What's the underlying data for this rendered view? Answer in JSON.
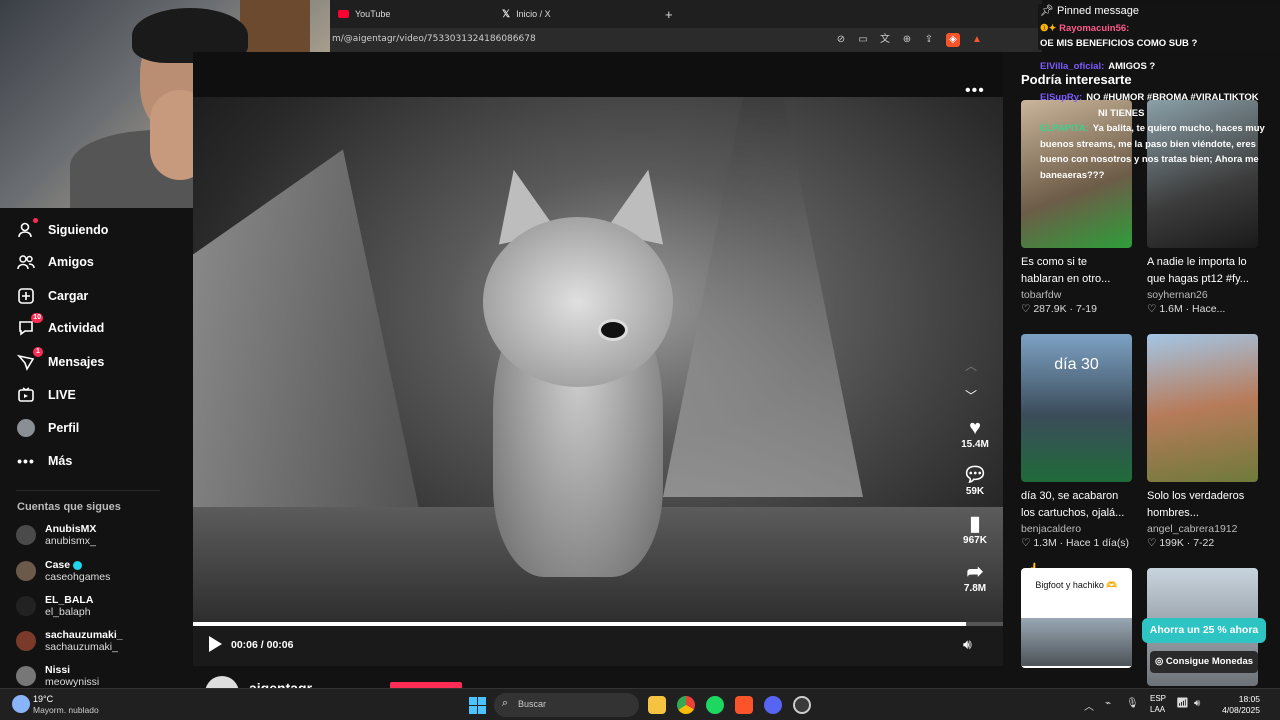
{
  "browser": {
    "tabs": [
      {
        "label": "YouTube"
      },
      {
        "label": "Inicio / X"
      }
    ],
    "new_tab": "+",
    "url": "m/@aigentagr/video/7533031324186086678"
  },
  "sidebar": {
    "items": [
      {
        "label": "Siguiendo",
        "icon": "following-icon"
      },
      {
        "label": "Amigos",
        "icon": "friends-icon"
      },
      {
        "label": "Cargar",
        "icon": "upload-icon"
      },
      {
        "label": "Actividad",
        "icon": "activity-icon",
        "badge": "10"
      },
      {
        "label": "Mensajes",
        "icon": "messages-icon",
        "badge": "1"
      },
      {
        "label": "LIVE",
        "icon": "live-icon"
      },
      {
        "label": "Perfil",
        "icon": "profile-icon"
      },
      {
        "label": "Más",
        "icon": "more-icon"
      }
    ],
    "following_title": "Cuentas que sigues",
    "accounts": [
      {
        "name": "AnubisMX",
        "handle": "anubismx_"
      },
      {
        "name": "Case",
        "handle": "caseohgames",
        "verified": true
      },
      {
        "name": "EL_BALA",
        "handle": "el_balaph"
      },
      {
        "name": "sachauzumaki_",
        "handle": "sachauzumaki_"
      },
      {
        "name": "Nissi",
        "handle": "meowynissi"
      }
    ]
  },
  "video": {
    "time": "00:06 / 00:06",
    "progress": 0.954,
    "author": "aigentagr",
    "more_label": "•••",
    "actions": [
      {
        "icon": "heart-icon",
        "count": "15.4M"
      },
      {
        "icon": "comment-icon",
        "count": "59K"
      },
      {
        "icon": "bookmark-icon",
        "count": "967K"
      },
      {
        "icon": "share-icon",
        "count": "7.8M"
      }
    ]
  },
  "chat": {
    "pinned_label": "Pinned message",
    "pinned_text": "OE MIS BENEFICIOS COMO SUB ?",
    "pinned_user": "Rayomacuin56:",
    "lines": [
      {
        "user": "ElVilla_oficial:",
        "text": "AMIGOS ?",
        "color": "#7d5bff"
      },
      {
        "user": "ElSupRy:",
        "text": "NO #HUMOR #BROMA #VIRALTIKTOK",
        "color": "#7d5bff"
      },
      {
        "user": "",
        "text": "NI TIENES",
        "color": "#7d5bff"
      },
      {
        "user": "ELPAPITA:",
        "text": "Ya balita, te quiero mucho, haces muy buenos streams, me la paso bien viéndote, eres bueno con nosotros y nos tratas bien; Ahora me baneaeras???",
        "color": "#3fcf8e"
      }
    ],
    "colors": {
      "pinned_user": "#ff5a8a",
      "accent": "#fe2c55"
    }
  },
  "recommendations": {
    "title": "Podría interesarte",
    "cards": [
      {
        "title": "Es como si te hablaran en otro...",
        "author": "tobarfdw",
        "likes": "287.9K",
        "date": "7-19"
      },
      {
        "title": "A nadie le importa lo que hagas pt12 #fy...",
        "author": "soyhernan26",
        "likes": "1.6M",
        "date": "Hace..."
      },
      {
        "title": "día 30, se acabaron los cartuchos, ojalá...",
        "author": "benjacaldero",
        "likes": "1.3M",
        "date": "Hace 1 día(s)",
        "thumb_text": "día 30"
      },
      {
        "title": "Solo los verdaderos hombres...",
        "author": "angel_cabrera1912",
        "likes": "199K",
        "date": "7-22"
      },
      {
        "title": "",
        "author": "",
        "likes": "",
        "date": "",
        "thumb_text": "Bigfoot y hachiko 🫶"
      },
      {
        "title": "",
        "author": "",
        "likes": "",
        "date": ""
      }
    ],
    "promo": "Ahorra un 25 % ahora",
    "coins_button": "Consigue Monedas"
  },
  "taskbar": {
    "weather_temp": "19°C",
    "weather_desc": "Mayorm. nublado",
    "search_placeholder": "Buscar",
    "lang1": "ESP",
    "lang2": "LAA",
    "time": "18:05",
    "date": "4/08/2025"
  }
}
